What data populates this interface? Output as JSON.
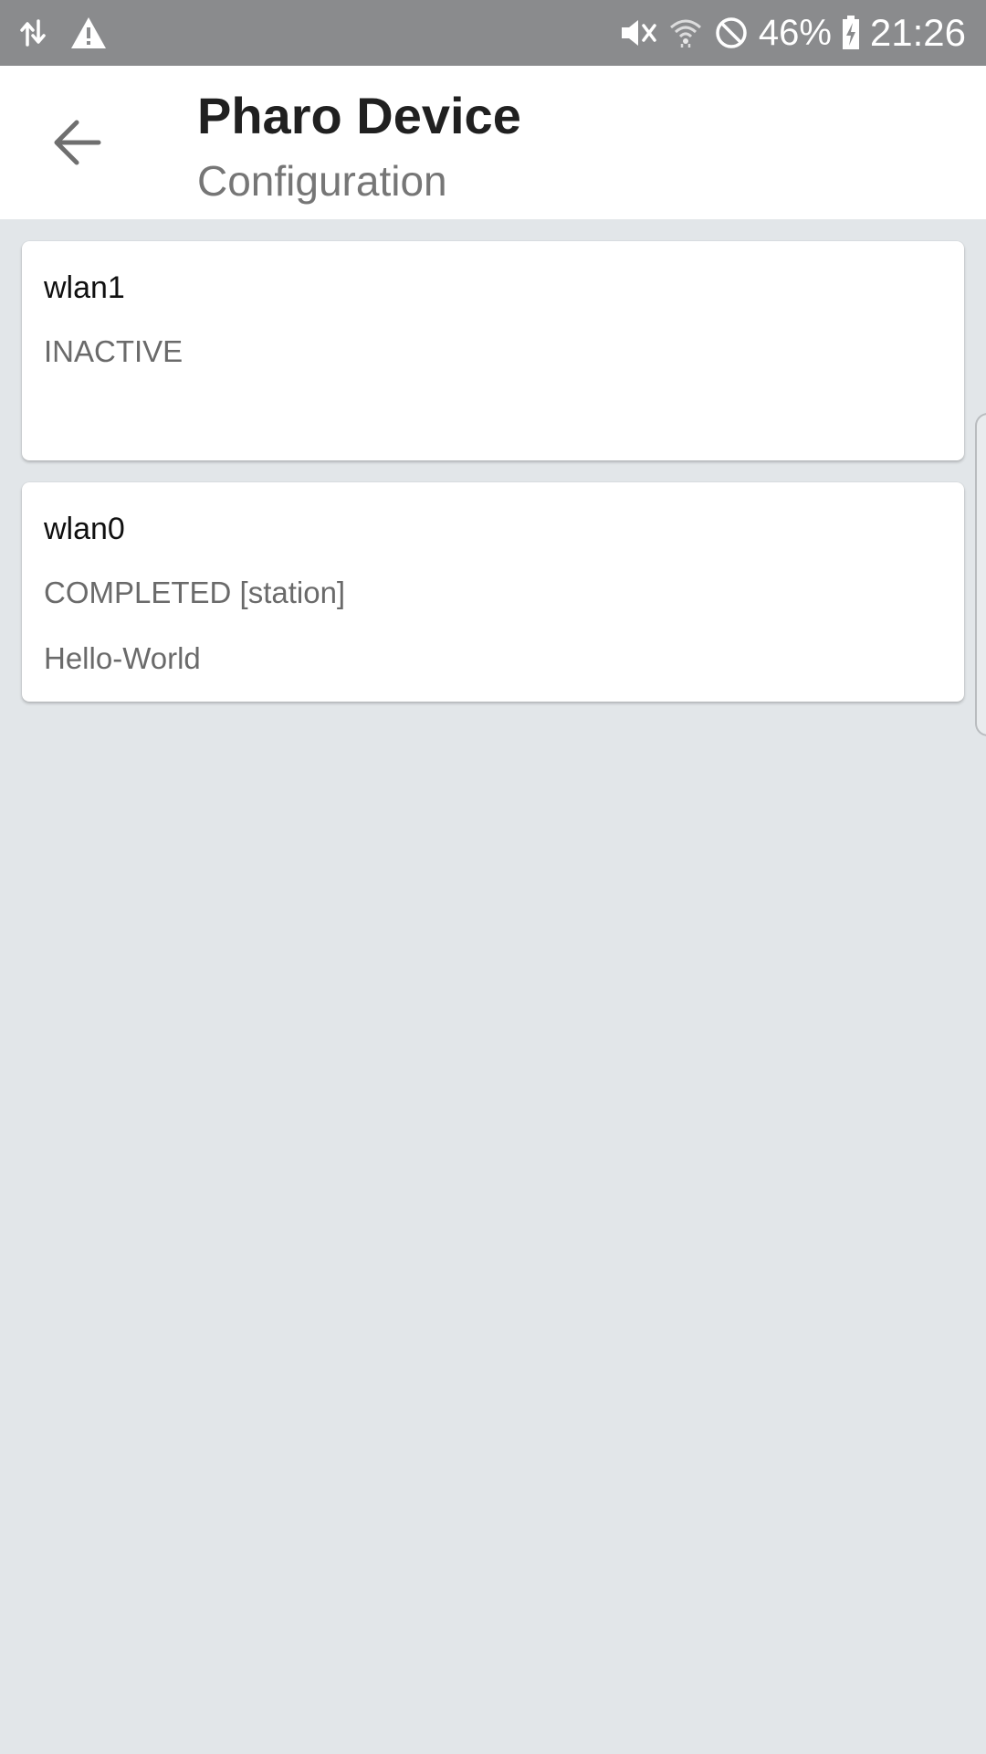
{
  "status_bar": {
    "left_icons": [
      "data-transfer-icon",
      "warning-icon"
    ],
    "right_icons": [
      "vibrate-icon",
      "wifi-icon",
      "do-not-disturb-icon",
      "battery-charging-icon"
    ],
    "battery_percent": "46%",
    "time": "21:26"
  },
  "app_bar": {
    "back_icon": "arrow-back-icon",
    "title": "Pharo Device",
    "subtitle": "Configuration"
  },
  "interfaces": [
    {
      "name": "wlan1",
      "state": "INACTIVE",
      "ssid": ""
    },
    {
      "name": "wlan0",
      "state": "COMPLETED [station]",
      "ssid": "Hello-World"
    }
  ],
  "colors": {
    "status_bar_bg": "#8a8b8d",
    "app_bar_bg": "#ffffff",
    "page_bg": "#e2e6e9",
    "card_bg": "#ffffff",
    "title_text": "#202020",
    "secondary_text": "#767676"
  }
}
